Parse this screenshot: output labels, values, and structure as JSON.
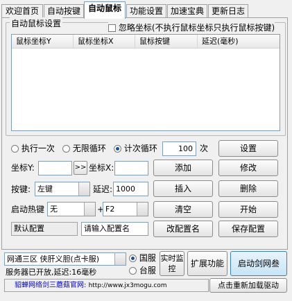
{
  "tabs": [
    "欢迎首页",
    "自动按键",
    "自动鼠标",
    "功能设置",
    "加速宝典",
    "更新日志"
  ],
  "active_tab_index": 2,
  "group_title": "自动鼠标设置",
  "ignore_coords_label": "忽略坐标(不执行鼠标坐标只执行鼠标按键)",
  "table_headers": [
    "鼠标坐标Y",
    "鼠标坐标X",
    "鼠标按键",
    "延迟(毫秒)"
  ],
  "loop": {
    "once": "执行一次",
    "infinite": "无限循环",
    "count": "计次循环",
    "count_value": "100",
    "count_unit": "次",
    "selected": "count"
  },
  "coords": {
    "y_label": "坐标Y:",
    "pick": ">>",
    "x_label": "坐标X:",
    "y_value": "",
    "x_value": ""
  },
  "key": {
    "label": "按键:",
    "value": "左键",
    "delay_label": "延迟:",
    "delay_value": "1000"
  },
  "hotkey": {
    "label": "启动热键",
    "mod": "无",
    "plus": "+",
    "key": "F2"
  },
  "config": {
    "default": "默认配置",
    "placeholder": "请输入配置名"
  },
  "buttons": {
    "settings": "设置",
    "add": "添加",
    "edit": "修改",
    "insert": "插入",
    "delete": "删除",
    "clear": "清空",
    "start": "开始",
    "rename": "改配置名",
    "save": "保存配置"
  },
  "server": {
    "selected": "网通三区  侠肝义胆(点卡服)",
    "status": "服务器已开放,延迟:16毫秒"
  },
  "region": {
    "cn": "国服",
    "tw": "台服",
    "selected": "cn"
  },
  "bottom_buttons": {
    "realtime": "实时监控",
    "extend": "扩展功能",
    "launch": "启动剑网叁",
    "reload": "点击重新加载驱动"
  },
  "footer": {
    "text": "貂蝉网络剑三蘑菇官网:",
    "url": "http://www.jx3mogu.com"
  }
}
